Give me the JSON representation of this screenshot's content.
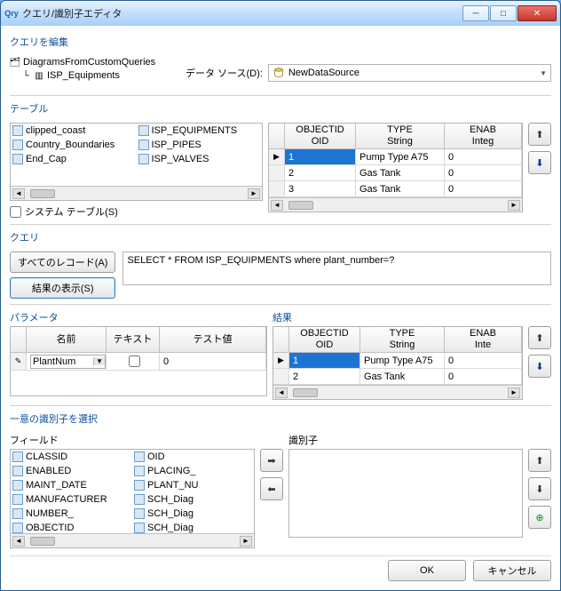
{
  "window": {
    "title": "クエリ/識別子エディタ"
  },
  "header": {
    "edit_label": "クエリを編集"
  },
  "tree": {
    "root": "DiagramsFromCustomQueries",
    "child": "ISP_Equipments"
  },
  "datasource": {
    "label": "データ ソース(D):",
    "value": "NewDataSource"
  },
  "tables": {
    "label": "テーブル",
    "left": [
      "clipped_coast",
      "Country_Boundaries",
      "End_Cap"
    ],
    "right": [
      "ISP_EQUIPMENTS",
      "ISP_PIPES",
      "ISP_VALVES"
    ],
    "system_label": "システム テーブル(S)"
  },
  "grid": {
    "columns": [
      {
        "name": "OBJECTID",
        "type": "OID"
      },
      {
        "name": "TYPE",
        "type": "String"
      },
      {
        "name": "ENAB",
        "type": "Integ"
      }
    ],
    "rows": [
      {
        "oid": "1",
        "type": "Pump Type A75",
        "enab": "0"
      },
      {
        "oid": "2",
        "type": "Gas Tank",
        "enab": "0"
      },
      {
        "oid": "3",
        "type": "Gas Tank",
        "enab": "0"
      }
    ]
  },
  "query": {
    "label": "クエリ",
    "all_records": "すべてのレコード(A)",
    "show_results": "結果の表示(S)",
    "sql": "SELECT * FROM ISP_EQUIPMENTS where plant_number=?"
  },
  "params": {
    "label": "パラメータ",
    "cols": {
      "name": "名前",
      "text": "テキスト",
      "test": "テスト値"
    },
    "row": {
      "name": "PlantNum",
      "text_checked": false,
      "test": "0"
    }
  },
  "results": {
    "label": "結果",
    "columns": [
      {
        "name": "OBJECTID",
        "type": "OID"
      },
      {
        "name": "TYPE",
        "type": "String"
      },
      {
        "name": "ENAB",
        "type": "Inte"
      }
    ],
    "rows": [
      {
        "oid": "1",
        "type": "Pump Type A75",
        "enab": "0"
      },
      {
        "oid": "2",
        "type": "Gas Tank",
        "enab": "0"
      }
    ]
  },
  "unique": {
    "label": "一意の識別子を選択",
    "fields_label": "フィールド",
    "id_label": "識別子",
    "left": [
      "CLASSID",
      "ENABLED",
      "MAINT_DATE",
      "MANUFACTURER",
      "NUMBER_",
      "OBJECTID"
    ],
    "right": [
      "OID",
      "PLACING_",
      "PLANT_NU",
      "SCH_Diag",
      "SCH_Diag",
      "SCH_Diag"
    ]
  },
  "footer": {
    "ok": "OK",
    "cancel": "キャンセル"
  }
}
